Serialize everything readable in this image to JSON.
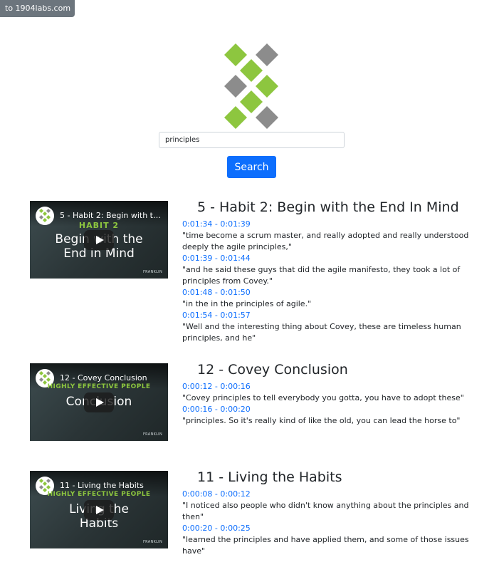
{
  "back_link": {
    "label": "to 1904labs.com"
  },
  "logo": {
    "colors": {
      "green": "#8dc63f",
      "gray": "#8c8c8c"
    }
  },
  "search": {
    "value": "principles",
    "button_label": "Search"
  },
  "colors": {
    "accent": "#0d6efd",
    "back_link_bg": "#6c757d"
  },
  "results": [
    {
      "title": "5 - Habit 2: Begin with the End In Mind",
      "video": {
        "title": "5 - Habit 2: Begin with the...",
        "subtitle": "",
        "big_line1": "HABIT 2",
        "big_line2": "Begin with the",
        "big_line3": "End in Mind",
        "mark": "FRANKLIN"
      },
      "snippets": [
        {
          "time": "0:01:34 - 0:01:39",
          "text": "\"time become a scrum master, and really adopted and really understood deeply the agile principles,\""
        },
        {
          "time": "0:01:39 - 0:01:44",
          "text": "\"and he said these guys that did the agile manifesto, they took a lot of principles from Covey.\""
        },
        {
          "time": "0:01:48 - 0:01:50",
          "text": "\"in the in the principles of agile.\""
        },
        {
          "time": "0:01:54 - 0:01:57",
          "text": "\"Well and the interesting thing about Covey, these are timeless human principles, and he\""
        }
      ]
    },
    {
      "title": "12 - Covey Conclusion",
      "video": {
        "title": "12 - Covey Conclusion",
        "subtitle": "HIGHLY EFFECTIVE PEOPLE",
        "big_line1": "Conclusion",
        "mark": "FRANKLIN"
      },
      "snippets": [
        {
          "time": "0:00:12 - 0:00:16",
          "text": "\"Covey principles to tell everybody you gotta, you have to adopt these\""
        },
        {
          "time": "0:00:16 - 0:00:20",
          "text": "\"principles. So it's really kind of like the old, you can lead the horse to\""
        }
      ]
    },
    {
      "title": "11 - Living the Habits",
      "video": {
        "title": "11 - Living the Habits",
        "subtitle": "HIGHLY EFFECTIVE PEOPLE",
        "big_line1": "Living the",
        "big_line2": "Habits",
        "mark": "FRANKLIN"
      },
      "snippets": [
        {
          "time": "0:00:08 - 0:00:12",
          "text": "\"I noticed also people who didn't know anything about the principles and then\""
        },
        {
          "time": "0:00:20 - 0:00:25",
          "text": "\"learned the principles and have applied them, and some of those issues have\""
        }
      ]
    }
  ]
}
